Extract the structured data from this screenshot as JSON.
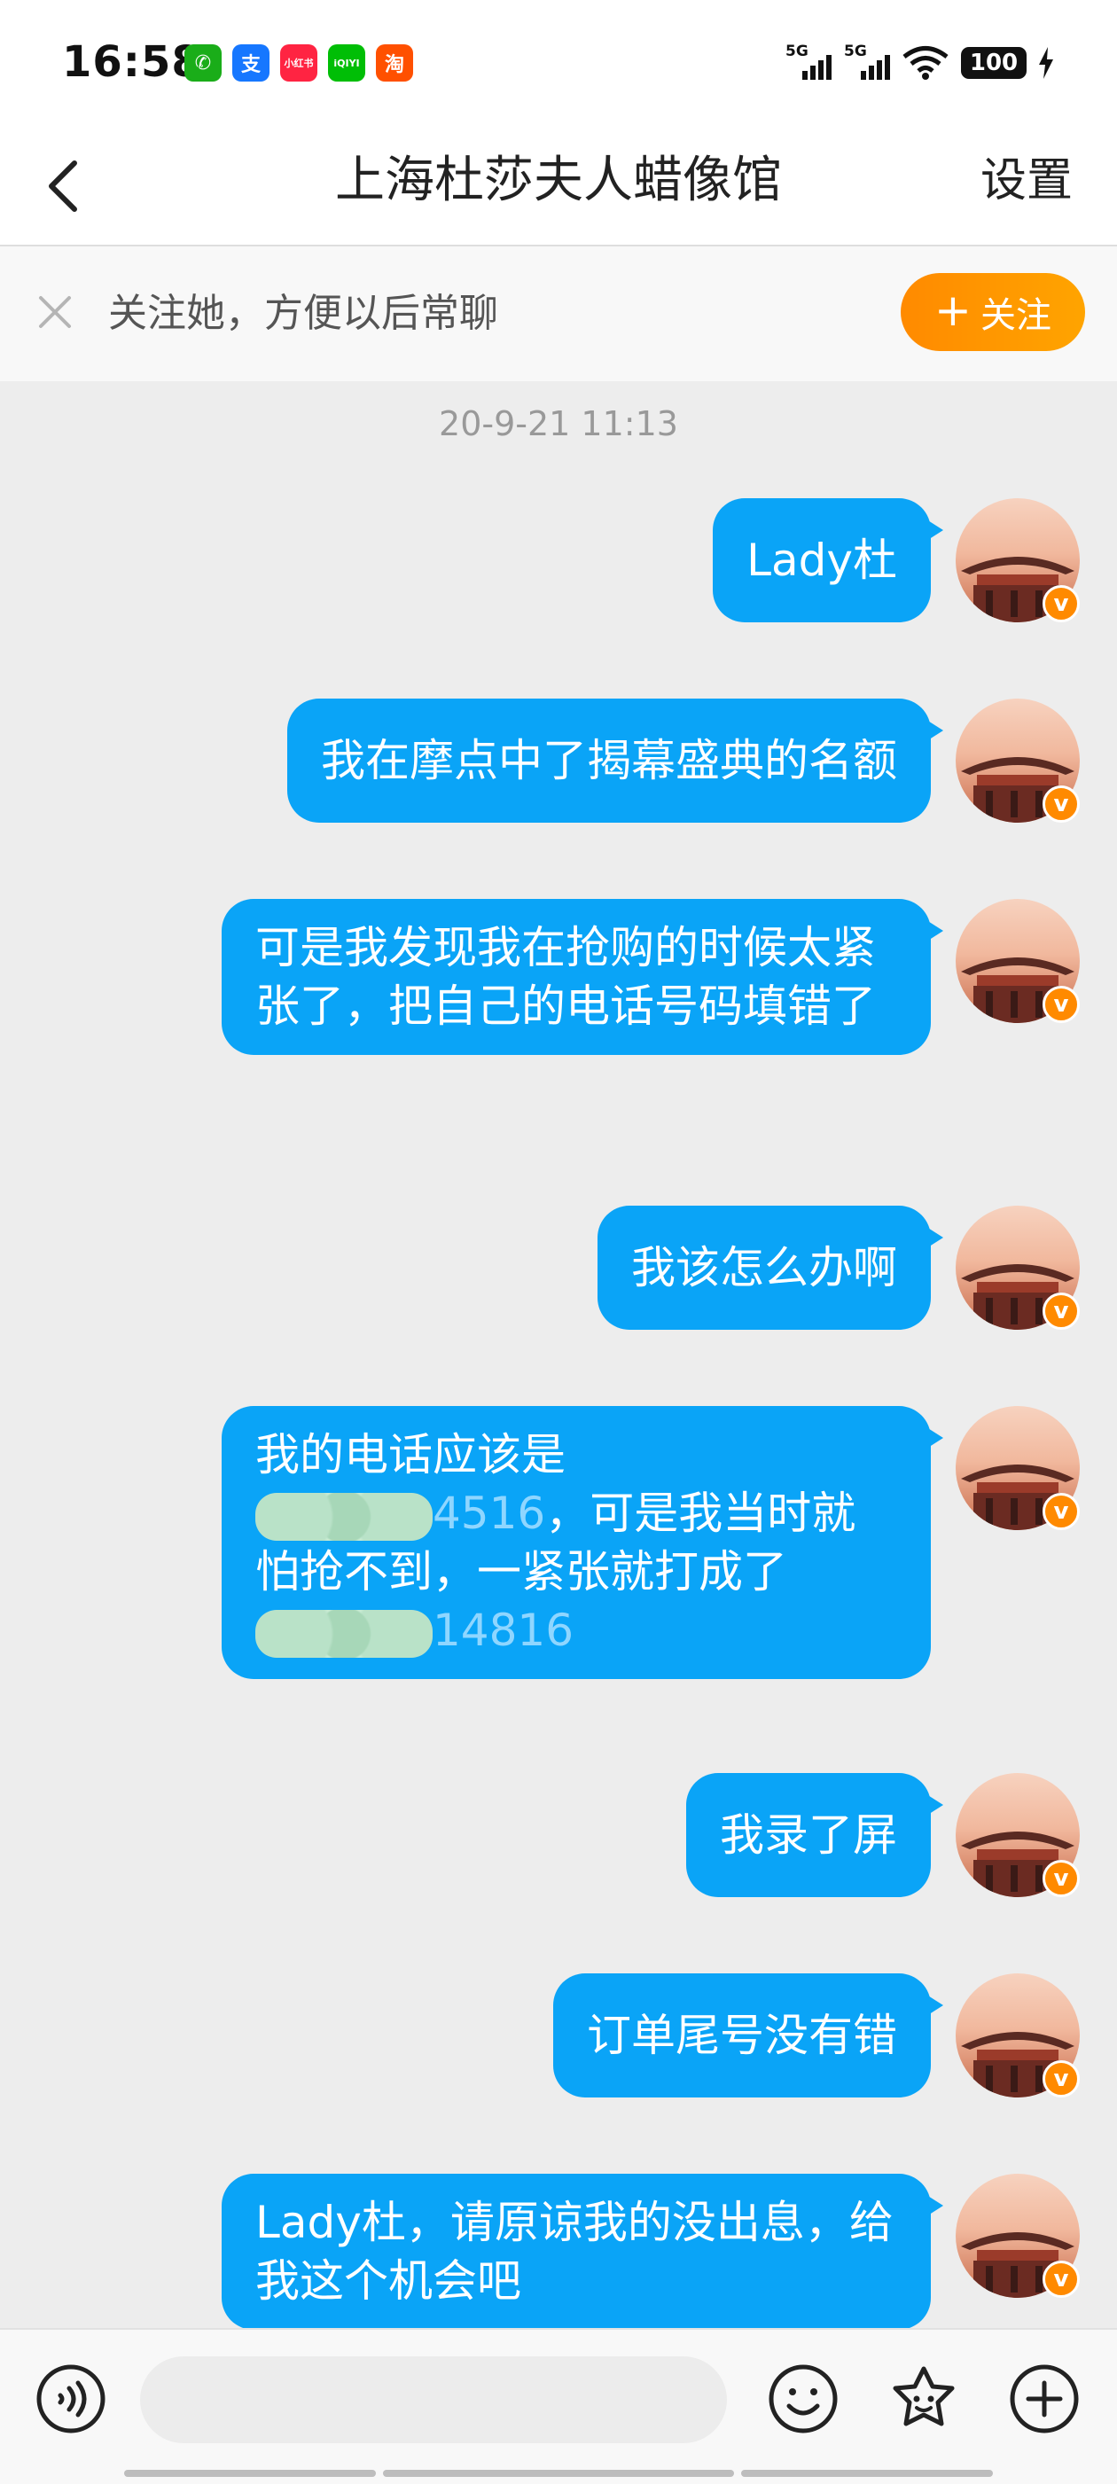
{
  "status_bar": {
    "time": "16:58",
    "apps": [
      {
        "name": "wechat-icon",
        "glyph": "✆",
        "color": "#1aad19"
      },
      {
        "name": "alipay-icon",
        "glyph": "支",
        "color": "#1677ff"
      },
      {
        "name": "xiaohongshu-icon",
        "glyph": "小红书",
        "color": "#ff2442"
      },
      {
        "name": "iqiyi-icon",
        "glyph": "iQIYI",
        "color": "#00be06"
      },
      {
        "name": "taobao-icon",
        "glyph": "淘",
        "color": "#ff5000"
      }
    ],
    "signal_1_label": "5G",
    "signal_2_label": "5G",
    "battery": "100"
  },
  "nav": {
    "title": "上海杜莎夫人蜡像馆",
    "settings": "设置"
  },
  "follow_bar": {
    "text": "关注她，方便以后常聊",
    "button_plus": "+",
    "button_label": "关注",
    "accent": "#ff8a00"
  },
  "chat": {
    "timestamp": "20-9-21 11:13",
    "bubble_color": "#0aa4f7",
    "messages": [
      {
        "text": "Lady杜"
      },
      {
        "text": "我在摩点中了揭幕盛典的名额"
      },
      {
        "text": "可是我发现我在抢购的时候太紧张了，把自己的电话号码填错了"
      },
      {
        "text": "我该怎么办啊"
      },
      {
        "line1": "我的电话应该是",
        "phone1_tail": "4516",
        "line2_rest": "，可是我当时就怕抢不到，一紧张就打成了",
        "phone2_tail": "14816"
      },
      {
        "text": "我录了屏"
      },
      {
        "text": "订单尾号没有错"
      },
      {
        "text": "Lady杜，请原谅我的没出息，给我这个机会吧"
      }
    ],
    "verified_badge": "v"
  },
  "input_bar": {
    "icons": [
      "voice-icon",
      "emoji-icon",
      "sticker-icon",
      "plus-icon"
    ]
  }
}
